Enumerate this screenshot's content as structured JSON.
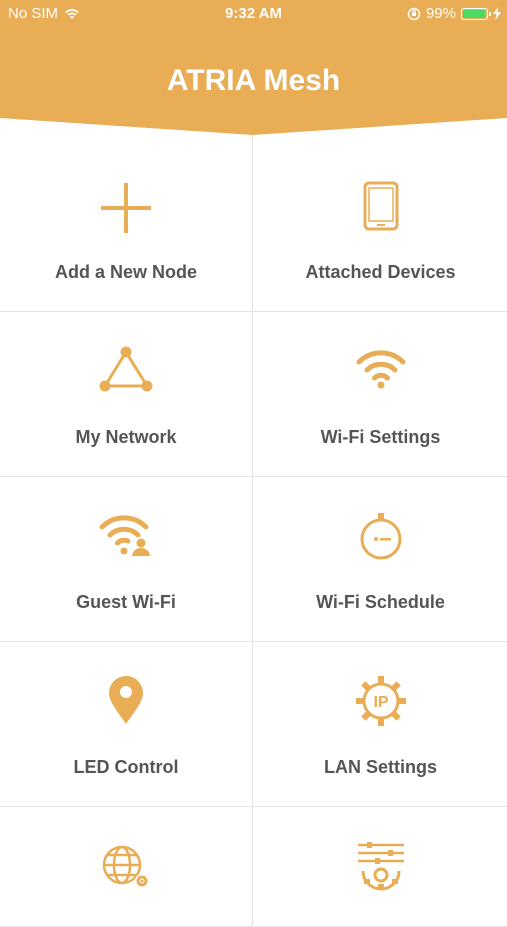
{
  "status_bar": {
    "carrier": "No SIM",
    "time": "9:32 AM",
    "battery_pct": "99%",
    "wifi_icon": "wifi-icon",
    "lock_icon": "rotation-lock-icon",
    "charging_icon": "charging-bolt-icon"
  },
  "header": {
    "title": "ATRIA Mesh",
    "color": "#e8ad55"
  },
  "menu": [
    {
      "label": "Add a New Node",
      "icon": "plus-icon"
    },
    {
      "label": "Attached Devices",
      "icon": "tablet-icon"
    },
    {
      "label": "My Network",
      "icon": "network-triangle-icon"
    },
    {
      "label": "Wi-Fi Settings",
      "icon": "wifi-icon"
    },
    {
      "label": "Guest Wi-Fi",
      "icon": "guest-wifi-icon"
    },
    {
      "label": "Wi-Fi Schedule",
      "icon": "timer-icon"
    },
    {
      "label": "LED Control",
      "icon": "location-pin-icon"
    },
    {
      "label": "LAN Settings",
      "icon": "ip-gear-icon"
    },
    {
      "label": "",
      "icon": "globe-gear-icon"
    },
    {
      "label": "",
      "icon": "sliders-gear-icon"
    }
  ]
}
